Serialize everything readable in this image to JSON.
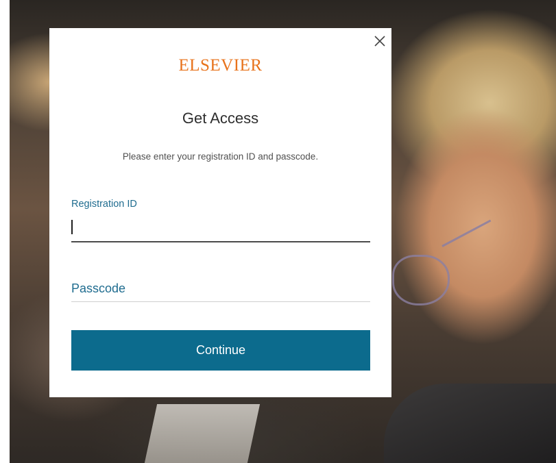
{
  "brand": {
    "logo_text": "ELSEVIER",
    "accent_color": "#e8731c"
  },
  "modal": {
    "title": "Get Access",
    "subtitle": "Please enter your registration ID and passcode.",
    "close_icon": "close-icon"
  },
  "form": {
    "registration_label": "Registration ID",
    "registration_value": "",
    "passcode_placeholder": "Passcode",
    "passcode_value": "",
    "continue_label": "Continue",
    "button_color": "#0c6b8d",
    "label_color": "#1f6c8f"
  }
}
